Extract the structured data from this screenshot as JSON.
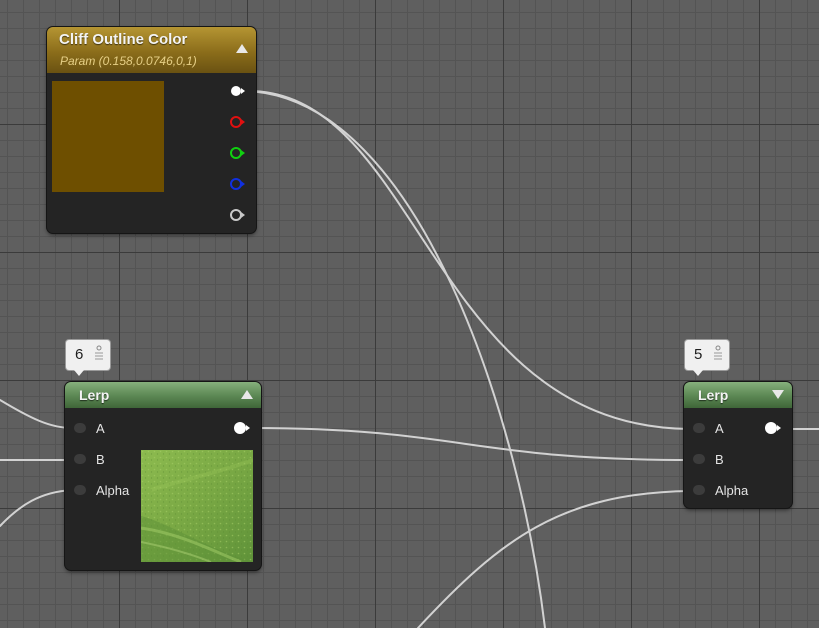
{
  "nodes": {
    "param": {
      "title": "Cliff Outline Color",
      "subtitle": "Param (0.158,0.0746,0,1)",
      "swatch_color": "#6e4f00",
      "header_color": "#8b6d1a",
      "outputs": [
        "rgba",
        "r",
        "g",
        "b",
        "a"
      ],
      "output_colors": [
        "#ffffff",
        "#e01010",
        "#10d010",
        "#1030e0",
        "#c8c8c8"
      ]
    },
    "lerp_left": {
      "title": "Lerp",
      "badge": "6",
      "inputs": [
        "A",
        "B",
        "Alpha"
      ],
      "header_color": "#5e8a56",
      "preview": "green-texture-preview"
    },
    "lerp_right": {
      "title": "Lerp",
      "badge": "5",
      "inputs": [
        "A",
        "B",
        "Alpha"
      ],
      "header_color": "#5e8a56"
    }
  },
  "wire_color": "#d6d6d6"
}
